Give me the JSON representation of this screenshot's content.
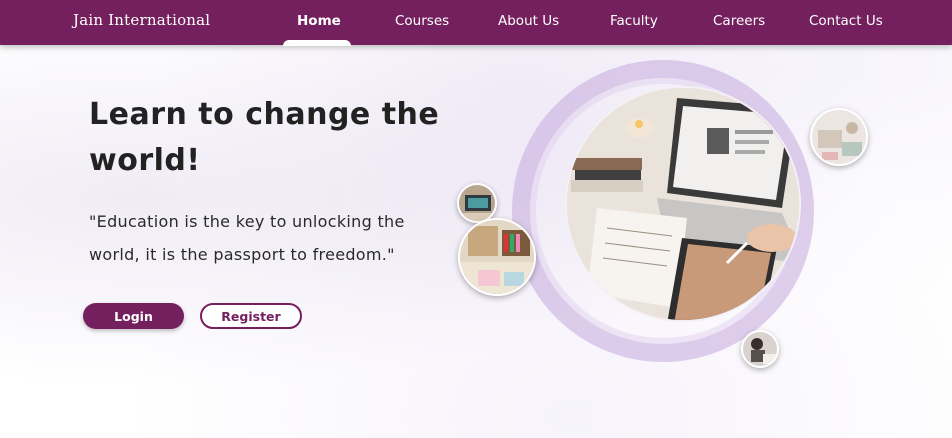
{
  "brand": "Jain International",
  "nav": {
    "items": [
      {
        "label": "Home",
        "active": true
      },
      {
        "label": "Courses",
        "active": false
      },
      {
        "label": "About Us",
        "active": false
      },
      {
        "label": "Faculty",
        "active": false
      },
      {
        "label": "Careers",
        "active": false
      },
      {
        "label": "Contact Us",
        "active": false
      }
    ]
  },
  "hero": {
    "title": "Learn to change the world!",
    "quote": "\"Education is the key to unlocking the world, it is the passport to freedom.\"",
    "login_label": "Login",
    "register_label": "Register"
  },
  "colors": {
    "primary": "#74205e",
    "ring": "#c4aadc"
  },
  "images": [
    {
      "icon": "study-desk-laptop-photo"
    },
    {
      "icon": "laptop-thumbnail-photo"
    },
    {
      "icon": "bookshelf-desk-thumbnail-photo"
    },
    {
      "icon": "desk-supplies-thumbnail-photo"
    },
    {
      "icon": "person-studying-thumbnail-photo"
    }
  ]
}
